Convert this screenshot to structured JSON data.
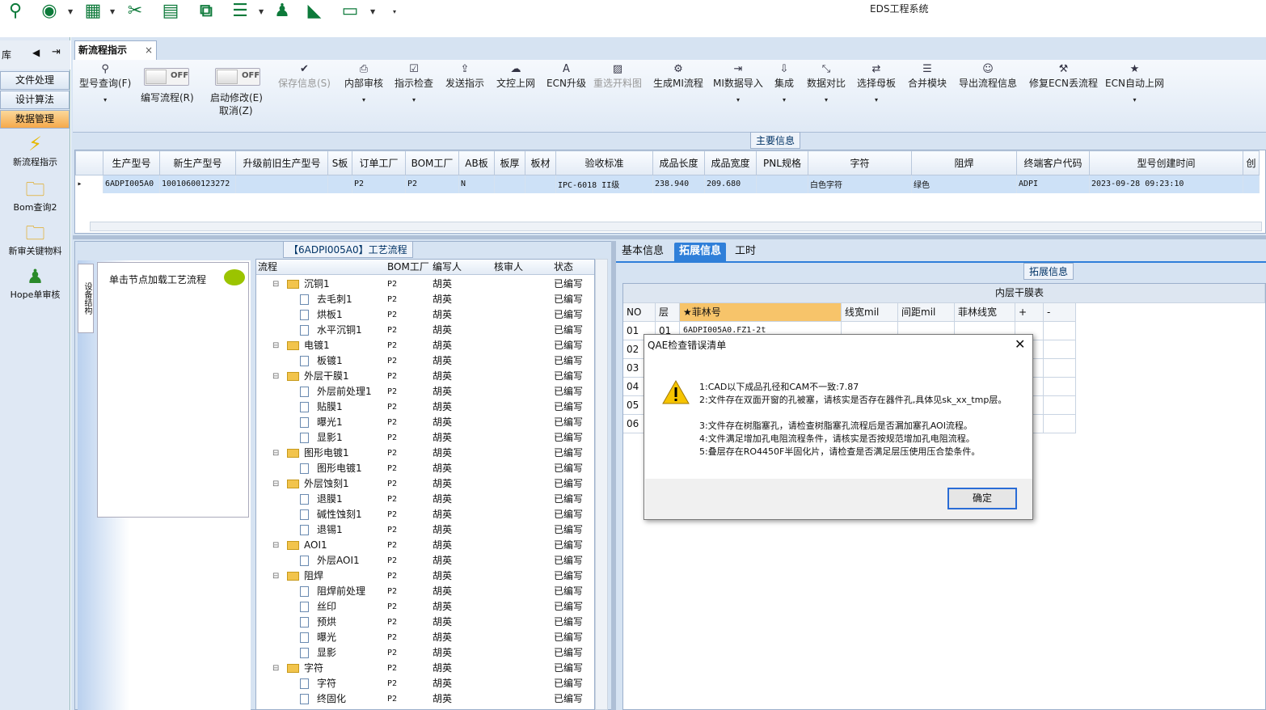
{
  "app_title": "EDS工程系统",
  "toolbar_icons": [
    "search-icon",
    "globe-icon",
    "table-icon",
    "scissors-icon",
    "film-icon",
    "copy-icon",
    "list-icon",
    "user-icon",
    "chart-icon",
    "window-icon"
  ],
  "left_panel": {
    "header": "库",
    "tabs": [
      "文件处理",
      "设计算法",
      "数据管理"
    ],
    "nav_items": [
      "新流程指示",
      "Bom查询2",
      "新审关键物料",
      "Hope单审核"
    ]
  },
  "doc_tab": {
    "label": "新流程指示",
    "close": "×"
  },
  "ribbon": {
    "query": "型号查询(F)",
    "toggle_off": "OFF",
    "edit_flow": "编写流程(R)",
    "start_modify": "启动修改(E)",
    "cancel": "取消(Z)",
    "save": "保存信息(S)",
    "internal_review": "内部审核",
    "check": "指示检查",
    "send": "发送指示",
    "upload": "文控上网",
    "ecn_upgrade": "ECN升级",
    "reselect": "重选开料图",
    "gen_mi": "生成MI流程",
    "mi_import": "MI数据导入",
    "integrate": "集成",
    "compare": "数据对比",
    "choose_board": "选择母板",
    "merge_module": "合并模块",
    "export_flow": "导出流程信息",
    "fix_ecn": "修复ECN丢流程",
    "ecn_auto": "ECN自动上网"
  },
  "main_info_label": "主要信息",
  "grid": {
    "columns": [
      "生产型号",
      "新生产型号",
      "升级前旧生产型号",
      "S板",
      "订单工厂",
      "BOM工厂",
      "AB板",
      "板厚",
      "板材",
      "验收标准",
      "成品长度",
      "成品宽度",
      "PNL规格",
      "字符",
      "阻焊",
      "终端客户代码",
      "型号创建时间",
      "创"
    ],
    "row": [
      "6ADPI005A0",
      "10010600123272",
      "",
      "",
      "P2",
      "P2",
      "N",
      "",
      "",
      "IPC-6018 II级",
      "238.940",
      "209.680",
      "",
      "白色字符",
      "绿色",
      "ADPI",
      "2023-09-28 09:23:10",
      ""
    ]
  },
  "flow_panel": {
    "title": "【6ADPI005A0】工艺流程",
    "vertical_tab": "设备结构",
    "tip": "单击节点加载工艺流程",
    "headers": [
      "流程",
      "BOM工厂",
      "编写人",
      "核审人",
      "状态"
    ],
    "rows": [
      {
        "name": "沉铜1",
        "level": 0,
        "bom": "P2",
        "writer": "胡英",
        "status": "已编写"
      },
      {
        "name": "去毛刺1",
        "level": 1,
        "bom": "P2",
        "writer": "胡英",
        "status": "已编写"
      },
      {
        "name": "烘板1",
        "level": 1,
        "bom": "P2",
        "writer": "胡英",
        "status": "已编写"
      },
      {
        "name": "水平沉铜1",
        "level": 1,
        "bom": "P2",
        "writer": "胡英",
        "status": "已编写"
      },
      {
        "name": "电镀1",
        "level": 0,
        "bom": "P2",
        "writer": "胡英",
        "status": "已编写"
      },
      {
        "name": "板镀1",
        "level": 1,
        "bom": "P2",
        "writer": "胡英",
        "status": "已编写"
      },
      {
        "name": "外层干膜1",
        "level": 0,
        "bom": "P2",
        "writer": "胡英",
        "status": "已编写"
      },
      {
        "name": "外层前处理1",
        "level": 1,
        "bom": "P2",
        "writer": "胡英",
        "status": "已编写"
      },
      {
        "name": "贴膜1",
        "level": 1,
        "bom": "P2",
        "writer": "胡英",
        "status": "已编写"
      },
      {
        "name": "曝光1",
        "level": 1,
        "bom": "P2",
        "writer": "胡英",
        "status": "已编写"
      },
      {
        "name": "显影1",
        "level": 1,
        "bom": "P2",
        "writer": "胡英",
        "status": "已编写"
      },
      {
        "name": "图形电镀1",
        "level": 0,
        "bom": "P2",
        "writer": "胡英",
        "status": "已编写"
      },
      {
        "name": "图形电镀1",
        "level": 1,
        "bom": "P2",
        "writer": "胡英",
        "status": "已编写"
      },
      {
        "name": "外层蚀刻1",
        "level": 0,
        "bom": "P2",
        "writer": "胡英",
        "status": "已编写"
      },
      {
        "name": "退膜1",
        "level": 1,
        "bom": "P2",
        "writer": "胡英",
        "status": "已编写"
      },
      {
        "name": "碱性蚀刻1",
        "level": 1,
        "bom": "P2",
        "writer": "胡英",
        "status": "已编写"
      },
      {
        "name": "退锡1",
        "level": 1,
        "bom": "P2",
        "writer": "胡英",
        "status": "已编写"
      },
      {
        "name": "AOI1",
        "level": 0,
        "bom": "P2",
        "writer": "胡英",
        "status": "已编写"
      },
      {
        "name": "外层AOI1",
        "level": 1,
        "bom": "P2",
        "writer": "胡英",
        "status": "已编写"
      },
      {
        "name": "阻焊",
        "level": 0,
        "bom": "P2",
        "writer": "胡英",
        "status": "已编写"
      },
      {
        "name": "阻焊前处理",
        "level": 1,
        "bom": "P2",
        "writer": "胡英",
        "status": "已编写"
      },
      {
        "name": "丝印",
        "level": 1,
        "bom": "P2",
        "writer": "胡英",
        "status": "已编写"
      },
      {
        "name": "预烘",
        "level": 1,
        "bom": "P2",
        "writer": "胡英",
        "status": "已编写"
      },
      {
        "name": "曝光",
        "level": 1,
        "bom": "P2",
        "writer": "胡英",
        "status": "已编写"
      },
      {
        "name": "显影",
        "level": 1,
        "bom": "P2",
        "writer": "胡英",
        "status": "已编写"
      },
      {
        "name": "字符",
        "level": 0,
        "bom": "P2",
        "writer": "胡英",
        "status": "已编写"
      },
      {
        "name": "字符",
        "level": 1,
        "bom": "P2",
        "writer": "胡英",
        "status": "已编写"
      },
      {
        "name": "终固化",
        "level": 1,
        "bom": "P2",
        "writer": "胡英",
        "status": "已编写"
      }
    ]
  },
  "right_panel": {
    "tabs": [
      "基本信息",
      "拓展信息",
      "工时"
    ],
    "ext_label": "拓展信息",
    "table_title": "内层干膜表",
    "headers": [
      "NO",
      "层",
      "★菲林号",
      "线宽mil",
      "间距mil",
      "菲林线宽",
      "+",
      "-"
    ],
    "rows": [
      [
        "01",
        "01",
        "6ADPI005A0.FZ1-2t"
      ],
      [
        "02",
        "",
        ""
      ],
      [
        "03",
        "",
        ""
      ],
      [
        "04",
        "",
        ""
      ],
      [
        "05",
        "",
        ""
      ],
      [
        "06",
        "",
        ""
      ]
    ]
  },
  "dialog": {
    "title": "QAE检查错误清单",
    "close": "✕",
    "messages": [
      "1:CAD以下成品孔径和CAM不一致:7.87",
      "2:文件存在双面开窗的孔被塞，请核实是否存在器件孔,具体见sk_xx_tmp层。",
      "3:文件存在树脂塞孔，请检查树脂塞孔流程后是否漏加塞孔AOI流程。",
      "4:文件满足增加孔电阻流程条件，请核实是否按规范增加孔电阻流程。",
      "5:叠层存在RO4450F半固化片，请检查是否满足层压使用压合垫条件。"
    ],
    "ok": "确定"
  }
}
